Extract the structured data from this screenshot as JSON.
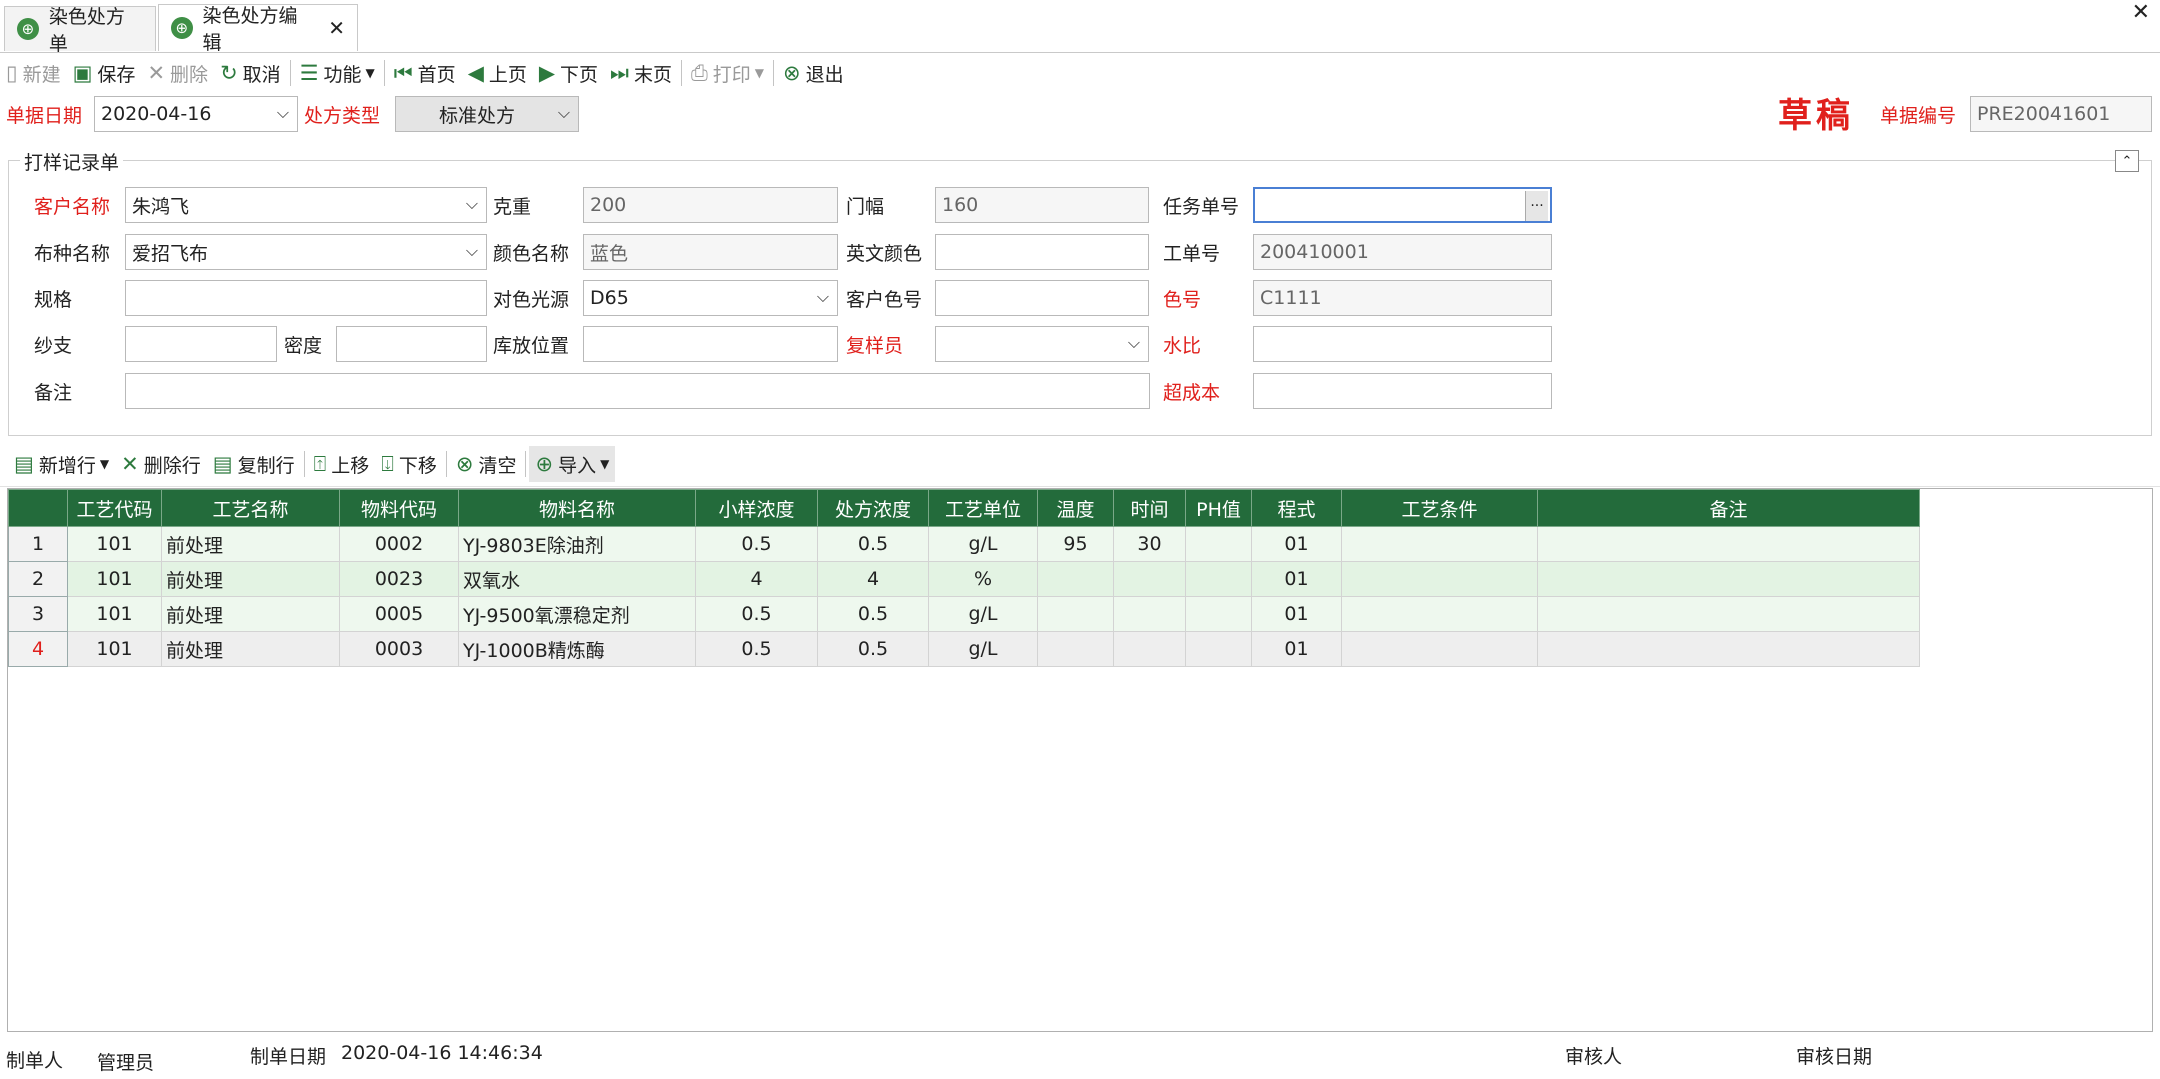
{
  "tabs": [
    {
      "label": "染色处方单"
    },
    {
      "label": "染色处方编辑"
    }
  ],
  "toolbar": {
    "new": "新建",
    "save": "保存",
    "delete": "删除",
    "cancel": "取消",
    "function": "功能",
    "first": "首页",
    "prev": "上页",
    "next": "下页",
    "last": "末页",
    "print": "打印",
    "exit": "退出"
  },
  "header": {
    "date_label": "单据日期",
    "date_value": "2020-04-16",
    "type_label": "处方类型",
    "type_value": "标准处方",
    "status": "草稿",
    "docno_label": "单据编号",
    "docno_value": "PRE20041601"
  },
  "group": {
    "title": "打样记录单",
    "customer_label": "客户名称",
    "customer_value": "朱鸿飞",
    "weight_label": "克重",
    "weight_value": "200",
    "width_label": "门幅",
    "width_value": "160",
    "task_label": "任务单号",
    "task_value": "",
    "fabric_label": "布种名称",
    "fabric_value": "爱招飞布",
    "color_label": "颜色名称",
    "color_value": "蓝色",
    "encolor_label": "英文颜色",
    "encolor_value": "",
    "workno_label": "工单号",
    "workno_value": "200410001",
    "spec_label": "规格",
    "spec_value": "",
    "light_label": "对色光源",
    "light_value": "D65",
    "custcolor_label": "客户色号",
    "custcolor_value": "",
    "colorno_label": "色号",
    "colorno_value": "C1111",
    "yarn_label": "纱支",
    "yarn_value": "",
    "density_label": "密度",
    "density_value": "",
    "storage_label": "库放位置",
    "storage_value": "",
    "checker_label": "复样员",
    "checker_value": "",
    "ratio_label": "水比",
    "ratio_value": "",
    "remark_label": "备注",
    "remark_value": "",
    "overcost_label": "超成本",
    "overcost_value": ""
  },
  "toolbar2": {
    "add_row": "新增行",
    "del_row": "删除行",
    "copy_row": "复制行",
    "up": "上移",
    "down": "下移",
    "clear": "清空",
    "import": "导入"
  },
  "grid": {
    "columns": [
      "",
      "工艺代码",
      "工艺名称",
      "物料代码",
      "物料名称",
      "小样浓度",
      "处方浓度",
      "工艺单位",
      "温度",
      "时间",
      "PH值",
      "程式",
      "工艺条件",
      "备注"
    ],
    "rows": [
      [
        "1",
        "101",
        "前处理",
        "0002",
        "YJ-9803E除油剂",
        "0.5",
        "0.5",
        "g/L",
        "95",
        "30",
        "",
        "01",
        "",
        ""
      ],
      [
        "2",
        "101",
        "前处理",
        "0023",
        "双氧水",
        "4",
        "4",
        "%",
        "",
        "",
        "",
        "01",
        "",
        ""
      ],
      [
        "3",
        "101",
        "前处理",
        "0005",
        "YJ-9500氧漂稳定剂",
        "0.5",
        "0.5",
        "g/L",
        "",
        "",
        "",
        "01",
        "",
        ""
      ],
      [
        "4",
        "101",
        "前处理",
        "0003",
        "YJ-1000B精炼酶",
        "0.5",
        "0.5",
        "g/L",
        "",
        "",
        "",
        "01",
        "",
        ""
      ]
    ]
  },
  "footer": {
    "maker_label": "制单人",
    "maker_value": "管理员",
    "makedate_label": "制单日期",
    "makedate_value": "2020-04-16 14:46:34",
    "auditor_label": "审核人",
    "auditdate_label": "审核日期"
  },
  "colors": {
    "accent": "#236b3b",
    "required": "#e0201c"
  }
}
